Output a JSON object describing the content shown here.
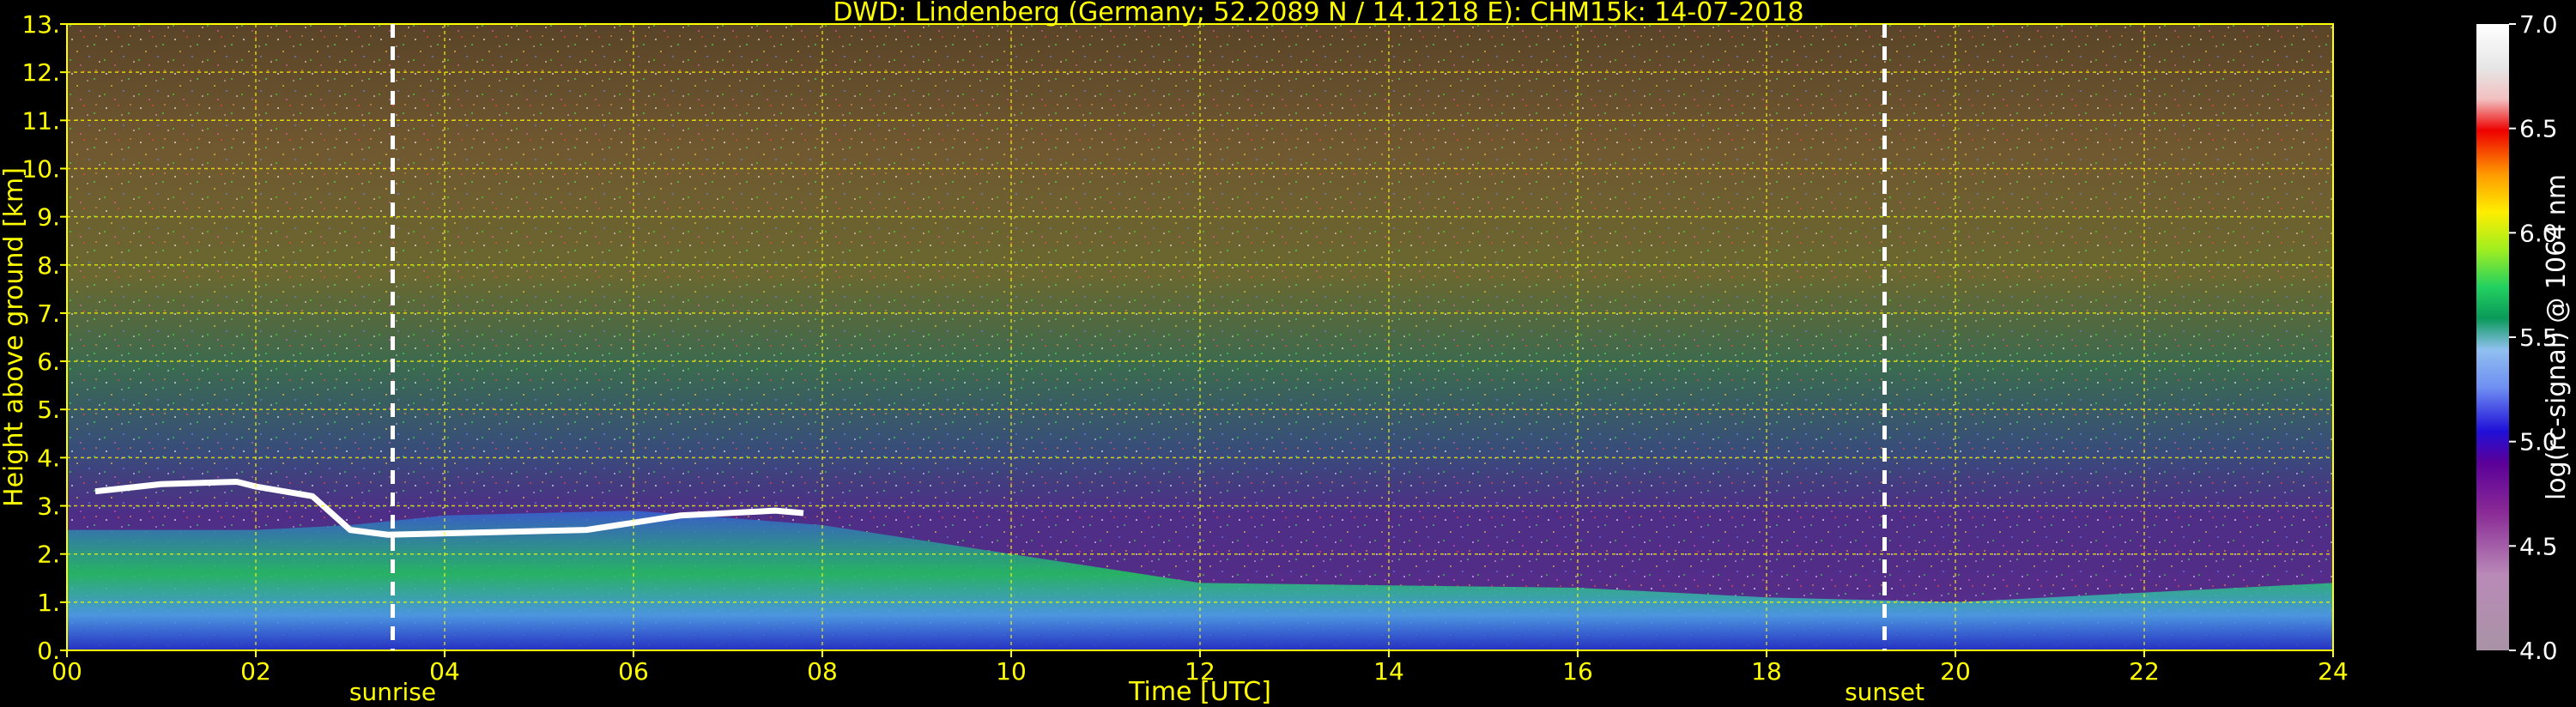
{
  "chart_data": {
    "type": "heatmap",
    "title": "DWD: Lindenberg (Germany; 52.2089 N / 14.1218 E):    CHM15k: 14-07-2018",
    "xlabel": "Time [UTC]",
    "ylabel": "Height above ground [km]",
    "xlim": [
      0,
      24
    ],
    "ylim": [
      0,
      13
    ],
    "x_ticks": [
      "00",
      "02",
      "04",
      "06",
      "08",
      "10",
      "12",
      "14",
      "16",
      "18",
      "20",
      "22",
      "24"
    ],
    "y_ticks": [
      "0.",
      "1.",
      "2.",
      "3.",
      "4.",
      "5.",
      "6.",
      "7.",
      "8.",
      "9.",
      "10.",
      "11.",
      "12.",
      "13."
    ],
    "grid": true,
    "markers": [
      {
        "label": "sunrise",
        "time": 3.45
      },
      {
        "label": "sunset",
        "time": 19.25
      }
    ],
    "colorbar": {
      "label": "log(rc-signal) @ 1064 nm",
      "range": [
        4.0,
        7.0
      ],
      "ticks": [
        "4.0",
        "4.5",
        "5.0",
        "5.5",
        "6.0",
        "6.5",
        "7.0"
      ]
    },
    "boundary_layer_top_km": {
      "time": [
        0,
        2,
        3,
        4,
        6,
        8,
        10,
        12,
        14,
        16,
        18,
        20,
        22,
        24
      ],
      "height": [
        2.5,
        2.5,
        2.6,
        2.8,
        2.9,
        2.6,
        2.0,
        1.4,
        1.35,
        1.3,
        1.1,
        1.0,
        1.2,
        1.4
      ]
    },
    "cloud_layer_km": {
      "time": [
        0.3,
        1.0,
        1.8,
        2.0,
        2.6,
        3.0,
        3.4,
        5.5,
        6.5,
        7.5,
        7.8
      ],
      "height": [
        3.3,
        3.45,
        3.5,
        3.4,
        3.2,
        2.5,
        2.4,
        2.5,
        2.8,
        2.9,
        2.85
      ]
    }
  }
}
